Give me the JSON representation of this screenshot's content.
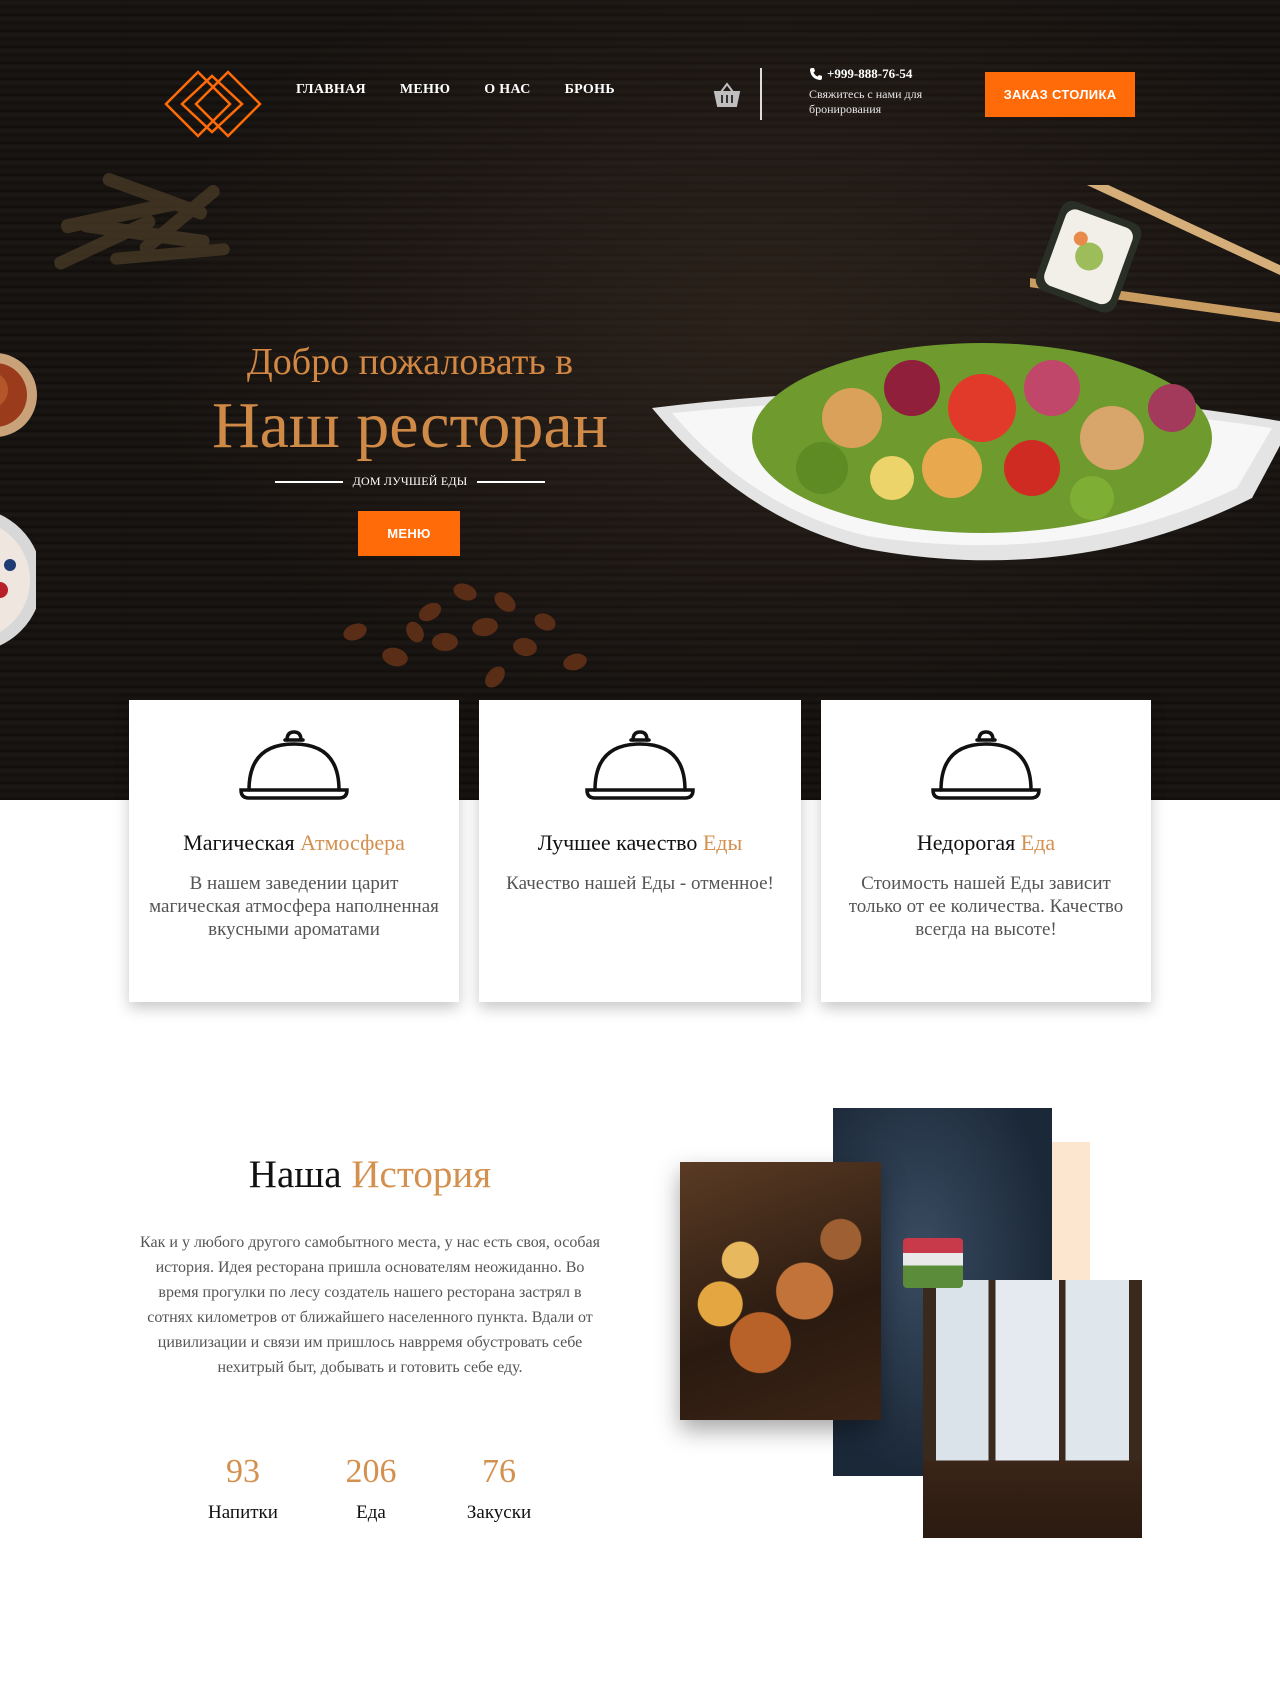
{
  "brand": {
    "accent": "#ff6b08",
    "gold": "#d4904e"
  },
  "header": {
    "nav": [
      "ГЛАВНАЯ",
      "МЕНЮ",
      "О НАС",
      "БРОНЬ"
    ],
    "phone": "+999-888-76-54",
    "contact_note": "Свяжитесь с нами для бронирования",
    "reserve_button": "ЗАКАЗ СТОЛИКА"
  },
  "hero": {
    "welcome": "Добро пожаловать в",
    "title": "Наш ресторан",
    "tagline": "ДОМ ЛУЧШЕЙ ЕДЫ",
    "menu_button": "МЕНЮ"
  },
  "features": [
    {
      "title": "Магическая",
      "title_accent": "Атмосфера",
      "text": "В нашем заведении царит магическая атмосфера наполненная вкусными ароматами",
      "icon": "cloche-icon"
    },
    {
      "title": "Лучшее качество",
      "title_accent": "Еды",
      "text": "Качество нашей Еды - отменное!",
      "icon": "cloche-icon"
    },
    {
      "title": "Недорогая",
      "title_accent": "Еда",
      "text": "Стоимость нашей Еды зависит только от ее количества. Качество всегда на высоте!",
      "icon": "cloche-icon"
    }
  ],
  "story": {
    "title": "Наша",
    "title_accent": "История",
    "text": "Как и у любого другого самобытного места, у нас есть своя, особая история. Идея ресторана пришла основателям неожиданно. Во время прогулки по лесу создатель нашего ресторана застрял в сотнях километров от ближайшего населенного пункта. Вдали от цивилизации и связи им пришлось наврремя обустровать себе нехитрый быт, добывать и готовить себе еду.",
    "stats": [
      {
        "value": "93",
        "label": "Напитки"
      },
      {
        "value": "206",
        "label": "Еда"
      },
      {
        "value": "76",
        "label": "Закуски"
      }
    ]
  }
}
